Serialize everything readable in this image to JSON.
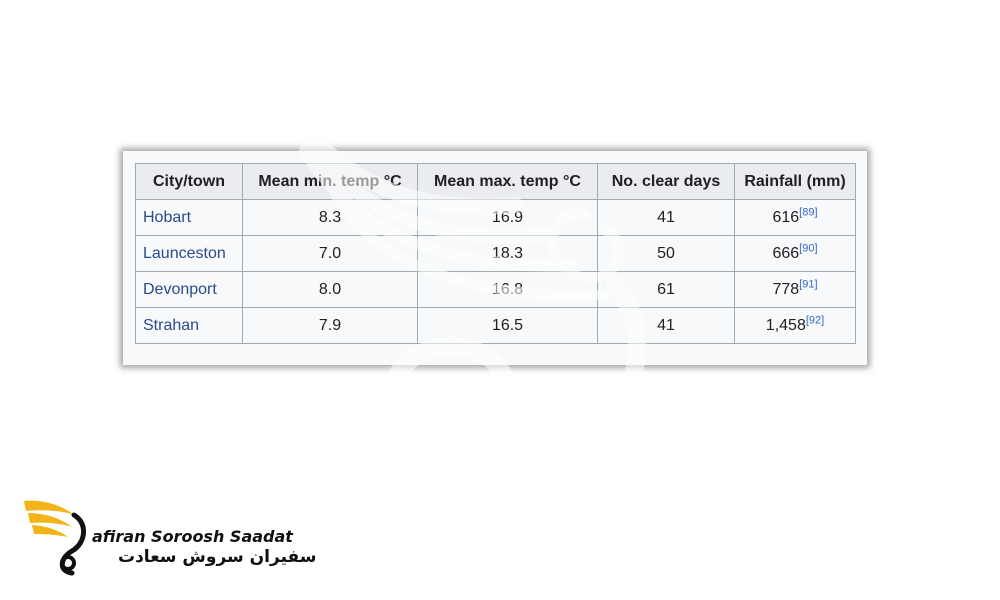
{
  "table": {
    "headers": [
      "City/town",
      "Mean min. temp °C",
      "Mean max. temp °C",
      "No. clear days",
      "Rainfall (mm)"
    ],
    "rows": [
      {
        "city": "Hobart",
        "min": "8.3",
        "max": "16.9",
        "clear": "41",
        "rain": "616",
        "ref": "[89]"
      },
      {
        "city": "Launceston",
        "min": "7.0",
        "max": "18.3",
        "clear": "50",
        "rain": "666",
        "ref": "[90]"
      },
      {
        "city": "Devonport",
        "min": "8.0",
        "max": "16.8",
        "clear": "61",
        "rain": "778",
        "ref": "[91]"
      },
      {
        "city": "Strahan",
        "min": "7.9",
        "max": "16.5",
        "clear": "41",
        "rain": "1,458",
        "ref": "[92]"
      }
    ]
  },
  "logo": {
    "text_en": "afiran Soroosh Saadat",
    "text_fa": "سفیران سروش سعادت"
  },
  "colors": {
    "link": "#2a4b8d",
    "reference": "#3366cc",
    "header_bg": "#eaecf0",
    "cell_bg": "#f8f9fa",
    "border": "#a2a9b1",
    "logo_gold": "#f2b418"
  },
  "icons": [
    "wing-watermark-icon",
    "wing-logo-icon"
  ]
}
